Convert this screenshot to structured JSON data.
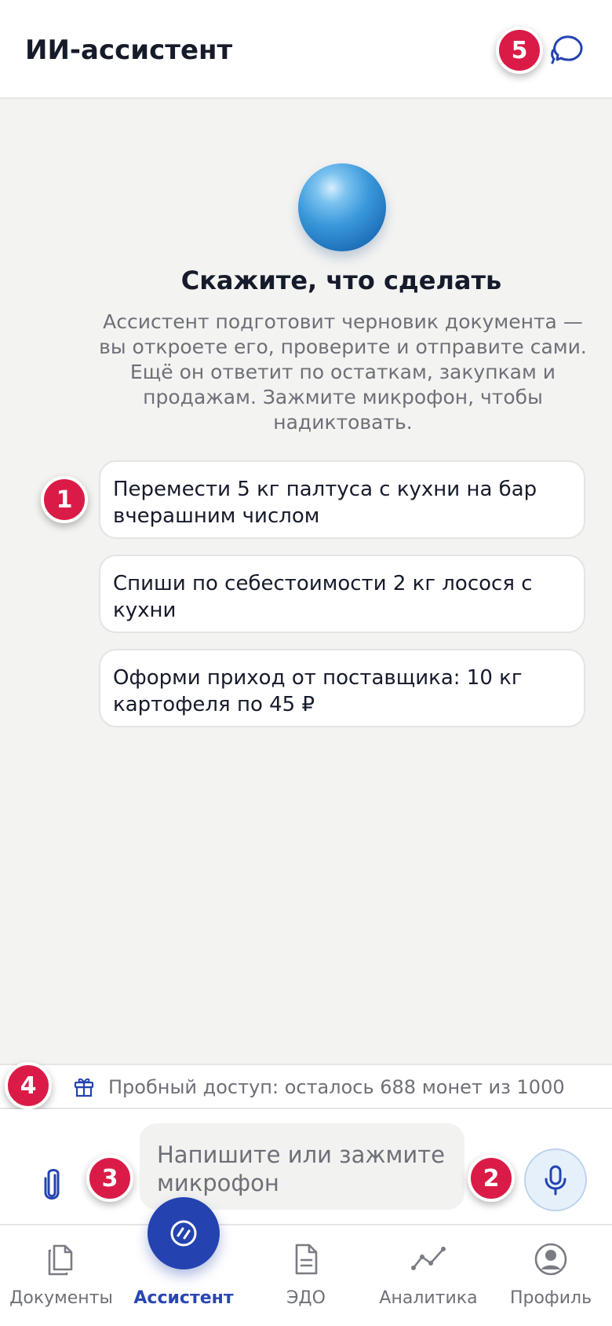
{
  "header": {
    "title": "ИИ-ассистент",
    "badge": "5"
  },
  "hero": {
    "title": "Скажите, что сделать",
    "description": "Ассистент подготовит черновик документа — вы откроете его, проверите и отправите сами. Ещё он ответит по остаткам, закупкам и продажам. Зажмите микрофон, чтобы надиктовать."
  },
  "suggestions": [
    {
      "text": "Перемести 5 кг палтуса с кухни на бар вчерашним числом",
      "badge": "1"
    },
    {
      "text": "Спиши по себестоимости 2 кг лосося с кухни"
    },
    {
      "text": "Оформи приход от поставщика: 10 кг картофеля по 45 ₽"
    }
  ],
  "trial": {
    "text": "Пробный доступ: осталось 688 монет из 1000",
    "badge": "4",
    "icon": "gift-icon"
  },
  "composer": {
    "placeholder": "Напишите или зажмите микрофон",
    "attach_badge": "3",
    "mic_badge": "2",
    "icons": [
      "paperclip-icon",
      "microphone-icon"
    ]
  },
  "tabbar": {
    "items": [
      {
        "label": "Документы",
        "icon": "documents-icon"
      },
      {
        "label": "Ассистент",
        "icon": "assistant-icon",
        "active": true
      },
      {
        "label": "ЭДО",
        "icon": "edo-document-icon"
      },
      {
        "label": "Аналитика",
        "icon": "analytics-icon"
      },
      {
        "label": "Профиль",
        "icon": "profile-icon"
      }
    ]
  },
  "colors": {
    "accent": "#2443b0",
    "badge": "#db1b47",
    "background": "#f3f3f1",
    "muted_text": "#6e7077"
  }
}
